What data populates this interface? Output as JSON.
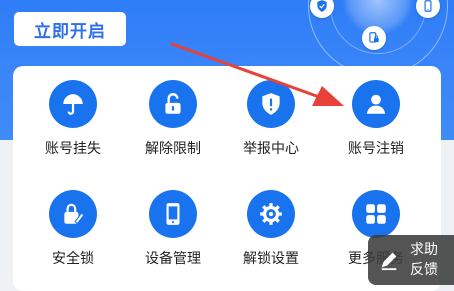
{
  "hero": {
    "start_label": "立即开启",
    "orbit_icons": [
      "shield-check-icon",
      "phone-icon",
      "lock-phone-icon"
    ]
  },
  "grid": {
    "items": [
      {
        "label": "账号挂失",
        "icon": "umbrella-icon"
      },
      {
        "label": "解除限制",
        "icon": "unlock-icon"
      },
      {
        "label": "举报中心",
        "icon": "alert-shield-icon"
      },
      {
        "label": "账号注销",
        "icon": "user-icon"
      },
      {
        "label": "安全锁",
        "icon": "lock-edit-icon"
      },
      {
        "label": "设备管理",
        "icon": "device-icon"
      },
      {
        "label": "解锁设置",
        "icon": "gear-icon"
      },
      {
        "label": "更多服务",
        "icon": "grid-icon"
      }
    ]
  },
  "help": {
    "line1": "求助",
    "line2": "反馈"
  },
  "colors": {
    "primary": "#1a73ee",
    "hero": "#3b86f8",
    "annotation_arrow": "#e8413a"
  }
}
